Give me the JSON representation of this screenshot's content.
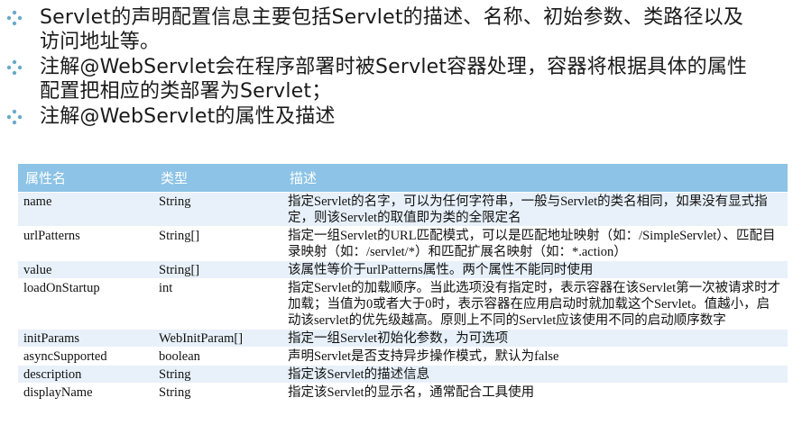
{
  "bullets": [
    {
      "icon": "diamond-bullet-icon",
      "text": "Servlet的声明配置信息主要包括Servlet的描述、名称、初始参数、类路径以及访问地址等。"
    },
    {
      "icon": "diamond-bullet-icon",
      "text": "注解@WebServlet会在程序部署时被Servlet容器处理，容器将根据具体的属性配置把相应的类部署为Servlet；"
    },
    {
      "icon": "diamond-bullet-icon",
      "text": "注解@WebServlet的属性及描述"
    }
  ],
  "table": {
    "headers": [
      "属性名",
      "类型",
      "描述"
    ],
    "rows": [
      [
        "name",
        "String",
        "指定Servlet的名字，可以为任何字符串，一般与Servlet的类名相同，如果没有显式指定，则该Servlet的取值即为类的全限定名"
      ],
      [
        "urlPatterns",
        "String[]",
        "指定一组Servlet的URL匹配模式，可以是匹配地址映射（如：/SimpleServlet）、匹配目录映射（如：/servlet/*）和匹配扩展名映射（如：*.action）"
      ],
      [
        "value",
        "String[]",
        "该属性等价于urlPatterns属性。两个属性不能同时使用"
      ],
      [
        "loadOnStartup",
        "int",
        "指定Servlet的加载顺序。当此选项没有指定时，表示容器在该Servlet第一次被请求时才加载；当值为0或者大于0时，表示容器在应用启动时就加载这个Servlet。值越小，启动该servlet的优先级越高。原则上不同的Servlet应该使用不同的启动顺序数字"
      ],
      [
        "initParams",
        "WebInitParam[]",
        "指定一组Servlet初始化参数，为可选项"
      ],
      [
        "asyncSupported",
        "boolean",
        "声明Servlet是否支持异步操作模式，默认为false"
      ],
      [
        "description",
        "String",
        "指定该Servlet的描述信息"
      ],
      [
        "displayName",
        "String",
        "指定该Servlet的显示名，通常配合工具使用"
      ]
    ]
  },
  "colors": {
    "header_bg": "#8cc3e6",
    "row_alt_bg": "#e8f1fa",
    "bullet_icon": "#6aa9c8"
  }
}
